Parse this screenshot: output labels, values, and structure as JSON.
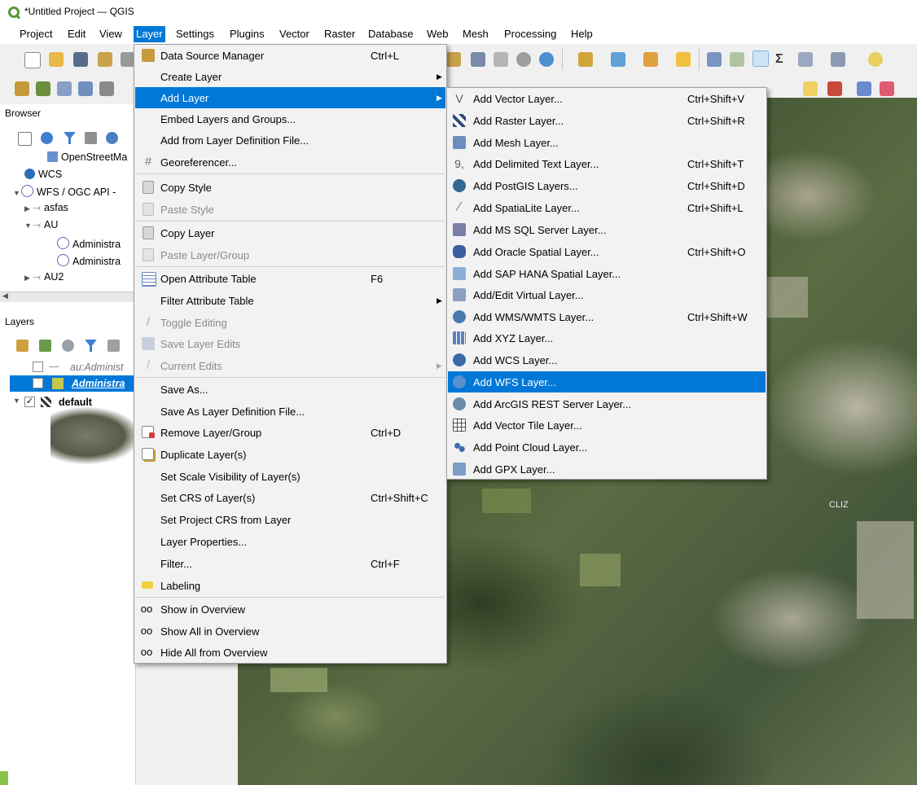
{
  "window": {
    "title": "*Untitled Project — QGIS"
  },
  "menubar": [
    "Project",
    "Edit",
    "View",
    "Layer",
    "Settings",
    "Plugins",
    "Vector",
    "Raster",
    "Database",
    "Web",
    "Mesh",
    "Processing",
    "Help"
  ],
  "browser": {
    "title": "Browser",
    "items": [
      {
        "label": "OpenStreetMa"
      },
      {
        "label": "WCS"
      },
      {
        "label": "WFS / OGC API -"
      },
      {
        "label": "asfas"
      },
      {
        "label": "AU"
      },
      {
        "label": "Administra"
      },
      {
        "label": "Administra"
      },
      {
        "label": "AU2"
      }
    ]
  },
  "layers": {
    "title": "Layers",
    "items": [
      {
        "label": "au:Administ"
      },
      {
        "label": "Administra"
      },
      {
        "label": "default"
      }
    ]
  },
  "layer_menu": [
    {
      "label": "Data Source Manager",
      "shortcut": "Ctrl+L",
      "icon": "data-source-manager-icon"
    },
    {
      "label": "Create Layer",
      "submenu": true
    },
    {
      "label": "Add Layer",
      "submenu": true,
      "highlight": true
    },
    {
      "label": "Embed Layers and Groups..."
    },
    {
      "label": "Add from Layer Definition File..."
    },
    {
      "label": "Georeferencer...",
      "icon": "georeferencer-icon"
    },
    {
      "label": "Copy Style",
      "icon": "copy-style-icon"
    },
    {
      "label": "Paste Style",
      "disabled": true,
      "icon": "paste-style-icon"
    },
    {
      "label": "Copy Layer",
      "icon": "copy-layer-icon"
    },
    {
      "label": "Paste Layer/Group",
      "disabled": true,
      "icon": "paste-layer-icon"
    },
    {
      "label": "Open Attribute Table",
      "shortcut": "F6",
      "icon": "attribute-table-icon"
    },
    {
      "label": "Filter Attribute Table",
      "submenu": true
    },
    {
      "label": "Toggle Editing",
      "disabled": true,
      "icon": "pencil-icon"
    },
    {
      "label": "Save Layer Edits",
      "disabled": true,
      "icon": "save-edits-icon"
    },
    {
      "label": "Current Edits",
      "disabled": true,
      "submenu": true,
      "icon": "current-edits-icon"
    },
    {
      "label": "Save As..."
    },
    {
      "label": "Save As Layer Definition File..."
    },
    {
      "label": "Remove Layer/Group",
      "shortcut": "Ctrl+D",
      "icon": "remove-layer-icon"
    },
    {
      "label": "Duplicate Layer(s)",
      "icon": "duplicate-layer-icon"
    },
    {
      "label": "Set Scale Visibility of Layer(s)"
    },
    {
      "label": "Set CRS of Layer(s)",
      "shortcut": "Ctrl+Shift+C"
    },
    {
      "label": "Set Project CRS from Layer"
    },
    {
      "label": "Layer Properties..."
    },
    {
      "label": "Filter...",
      "shortcut": "Ctrl+F"
    },
    {
      "label": "Labeling",
      "icon": "labeling-icon"
    },
    {
      "label": "Show in Overview",
      "icon": "show-overview-icon"
    },
    {
      "label": "Show All in Overview",
      "icon": "show-all-overview-icon"
    },
    {
      "label": "Hide All from Overview",
      "icon": "hide-overview-icon"
    }
  ],
  "add_layer_menu": [
    {
      "label": "Add Vector Layer...",
      "shortcut": "Ctrl+Shift+V",
      "icon": "vector-layer-icon"
    },
    {
      "label": "Add Raster Layer...",
      "shortcut": "Ctrl+Shift+R",
      "icon": "raster-layer-icon"
    },
    {
      "label": "Add Mesh Layer...",
      "icon": "mesh-layer-icon"
    },
    {
      "label": "Add Delimited Text Layer...",
      "shortcut": "Ctrl+Shift+T",
      "icon": "delimited-text-icon"
    },
    {
      "label": "Add PostGIS Layers...",
      "shortcut": "Ctrl+Shift+D",
      "icon": "postgis-icon"
    },
    {
      "label": "Add SpatiaLite Layer...",
      "shortcut": "Ctrl+Shift+L",
      "icon": "spatialite-icon"
    },
    {
      "label": "Add MS SQL Server Layer...",
      "icon": "mssql-icon"
    },
    {
      "label": "Add Oracle Spatial Layer...",
      "shortcut": "Ctrl+Shift+O",
      "icon": "oracle-icon"
    },
    {
      "label": "Add SAP HANA Spatial Layer...",
      "icon": "sap-hana-icon"
    },
    {
      "label": "Add/Edit Virtual Layer...",
      "icon": "virtual-layer-icon"
    },
    {
      "label": "Add WMS/WMTS Layer...",
      "shortcut": "Ctrl+Shift+W",
      "icon": "wms-icon"
    },
    {
      "label": "Add XYZ Layer...",
      "icon": "xyz-icon"
    },
    {
      "label": "Add WCS Layer...",
      "icon": "wcs-icon"
    },
    {
      "label": "Add WFS Layer...",
      "highlight": true,
      "icon": "wfs-icon"
    },
    {
      "label": "Add ArcGIS REST Server Layer...",
      "icon": "arcgis-icon"
    },
    {
      "label": "Add Vector Tile Layer...",
      "icon": "vector-tile-icon"
    },
    {
      "label": "Add Point Cloud Layer...",
      "icon": "point-cloud-icon"
    },
    {
      "label": "Add GPX Layer...",
      "icon": "gpx-icon"
    }
  ],
  "map": {
    "town_label": "CLIZ"
  },
  "colors": {
    "highlight": "#0078d7",
    "qgis_green": "#589632"
  }
}
